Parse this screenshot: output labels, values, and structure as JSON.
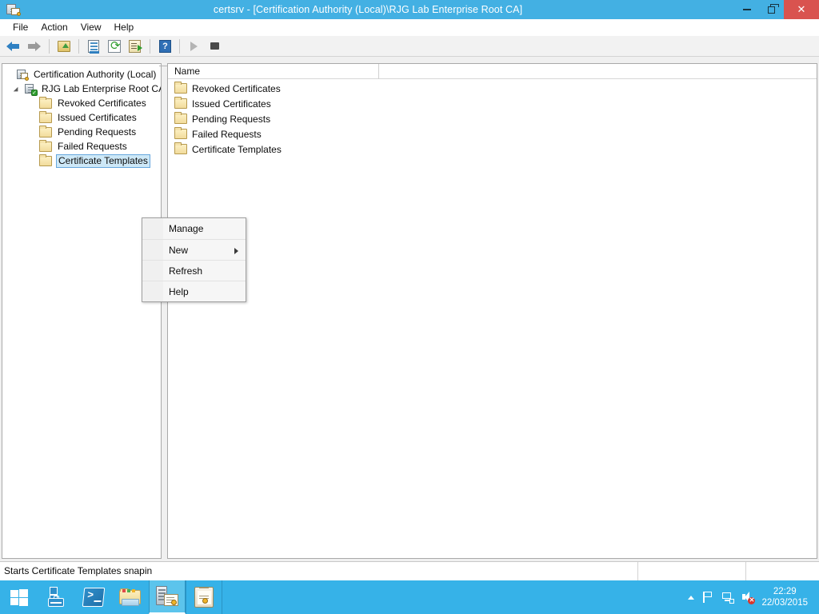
{
  "window": {
    "title": "certsrv - [Certification Authority (Local)\\RJG Lab Enterprise Root CA]",
    "icon": "certsrv-icon",
    "minimize_label": "Minimize",
    "maximize_label": "Restore",
    "close_label": "Close"
  },
  "menubar": {
    "items": [
      {
        "label": "File"
      },
      {
        "label": "Action"
      },
      {
        "label": "View"
      },
      {
        "label": "Help"
      }
    ]
  },
  "toolbar": {
    "buttons": [
      {
        "name": "back-icon",
        "label": "Back"
      },
      {
        "name": "forward-icon",
        "label": "Forward"
      },
      {
        "name": "up-one-level-icon",
        "label": "Up One Level"
      },
      {
        "name": "properties-icon",
        "label": "Properties"
      },
      {
        "name": "refresh-icon",
        "label": "Refresh"
      },
      {
        "name": "export-list-icon",
        "label": "Export List"
      },
      {
        "name": "help-icon",
        "label": "Help"
      },
      {
        "name": "start-service-icon",
        "label": "Start Service"
      },
      {
        "name": "stop-service-icon",
        "label": "Stop Service"
      }
    ]
  },
  "tree": {
    "root": {
      "label": "Certification Authority (Local)",
      "icon": "ca-server-icon"
    },
    "ca_node": {
      "label": "RJG Lab Enterprise Root CA",
      "icon": "ca-running-icon",
      "expanded": true
    },
    "children": [
      {
        "label": "Revoked Certificates",
        "icon": "folder-icon",
        "selected": false
      },
      {
        "label": "Issued Certificates",
        "icon": "folder-icon",
        "selected": false
      },
      {
        "label": "Pending Requests",
        "icon": "folder-icon",
        "selected": false
      },
      {
        "label": "Failed Requests",
        "icon": "folder-icon",
        "selected": false
      },
      {
        "label": "Certificate Templates",
        "icon": "folder-icon",
        "selected": true
      }
    ]
  },
  "list": {
    "column_header": "Name",
    "rows": [
      {
        "label": "Revoked Certificates",
        "icon": "folder-icon"
      },
      {
        "label": "Issued Certificates",
        "icon": "folder-icon"
      },
      {
        "label": "Pending Requests",
        "icon": "folder-icon"
      },
      {
        "label": "Failed Requests",
        "icon": "folder-icon"
      },
      {
        "label": "Certificate Templates",
        "icon": "folder-icon"
      }
    ]
  },
  "context_menu": {
    "visible": true,
    "items": [
      {
        "label": "Manage",
        "has_submenu": false
      },
      {
        "label": "New",
        "has_submenu": true
      },
      {
        "label": "Refresh",
        "has_submenu": false
      },
      {
        "label": "Help",
        "has_submenu": false
      }
    ]
  },
  "statusbar": {
    "message": "Starts Certificate Templates snapin"
  },
  "taskbar": {
    "start_label": "Start",
    "apps": [
      {
        "name": "server-manager-icon",
        "label": "Server Manager",
        "state": "pinned"
      },
      {
        "name": "powershell-icon",
        "label": "Windows PowerShell",
        "state": "pinned"
      },
      {
        "name": "file-explorer-icon",
        "label": "File Explorer",
        "state": "pinned"
      },
      {
        "name": "certsrv-icon",
        "label": "certsrv",
        "state": "active"
      },
      {
        "name": "certificate-templates-console-icon",
        "label": "Certificate Templates Console",
        "state": "open"
      }
    ],
    "tray": [
      {
        "name": "show-hidden-icons-icon",
        "label": "Show hidden icons"
      },
      {
        "name": "action-center-flag-icon",
        "label": "Action Center"
      },
      {
        "name": "network-icon",
        "label": "Network"
      },
      {
        "name": "volume-muted-icon",
        "label": "Volume muted"
      }
    ],
    "clock": {
      "time": "22:29",
      "date": "22/03/2015"
    }
  },
  "colors": {
    "titlebar": "#43b0e3",
    "taskbar": "#36b2e8",
    "close_button": "#d9534f",
    "selection": "#cde8f7",
    "selection_border": "#66a7dd"
  }
}
